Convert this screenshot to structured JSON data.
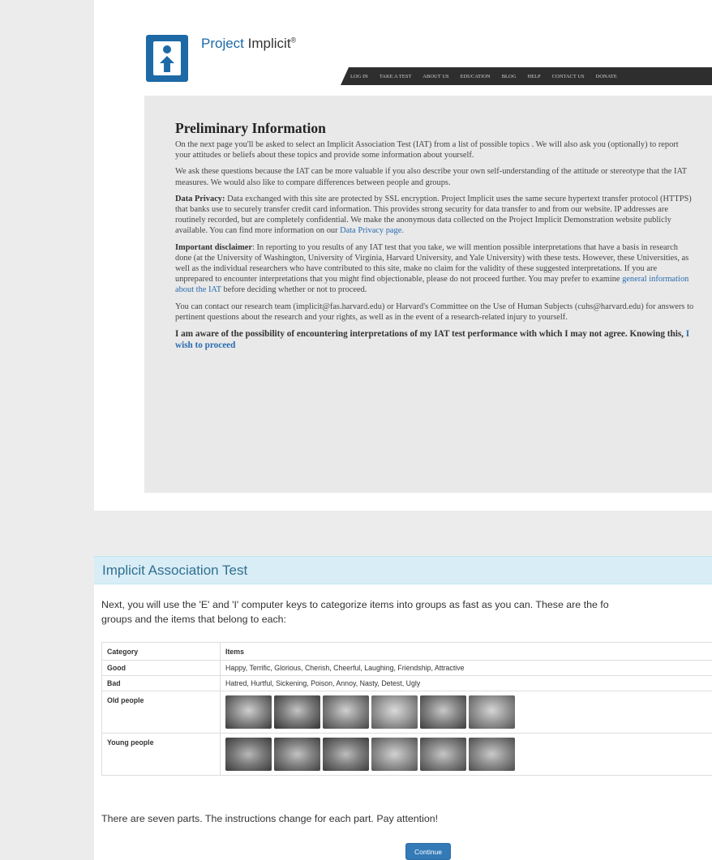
{
  "brand": {
    "name_part1": "Project",
    "name_part2": " Implicit",
    "mark": "®"
  },
  "nav": {
    "items": [
      "LOG IN",
      "TAKE A TEST",
      "ABOUT US",
      "EDUCATION",
      "BLOG",
      "HELP",
      "CONTACT US",
      "DONATE"
    ]
  },
  "prelim": {
    "title": "Preliminary Information",
    "p1": "On the next page you'll be asked to select an Implicit Association Test (IAT) from a list of possible topics . We will also ask you (optionally) to report your attitudes or beliefs about these topics and provide some information about yourself.",
    "p2": "We ask these questions because the IAT can be more valuable if you also describe your own self-understanding of the attitude or stereotype that the IAT measures. We would also like to compare differences between people and groups.",
    "privacy_label": "Data Privacy:",
    "privacy_text": " Data exchanged with this site are protected by SSL encryption. Project Implicit uses the same secure hypertext transfer protocol (HTTPS) that banks use to securely transfer credit card information. This provides strong security for data transfer to and from our website. IP addresses are routinely recorded, but are completely confidential. We make the anonymous data collected on the Project Implicit Demonstration website publicly available. You can find more information on our ",
    "privacy_link": "Data Privacy page.",
    "disclaimer_label": "Important disclaimer",
    "disclaimer_text": ": In reporting to you results of any IAT test that you take, we will mention possible interpretations that have a basis in research done (at the University of Washington, University of Virginia, Harvard University, and Yale University) with these tests. However, these Universities, as well as the individual researchers who have contributed to this site, make no claim for the validity of these suggested interpretations. If you are unprepared to encounter interpretations that you might find objectionable, please do not proceed further. You may prefer to examine ",
    "disclaimer_link": "general information about the IAT",
    "disclaimer_tail": " before deciding whether or not to proceed.",
    "contact": "You can contact our research team (implicit@fas.harvard.edu) or Harvard's Committee on the Use of Human Subjects (cuhs@harvard.edu) for answers to pertinent questions about the research and your rights, as well as in the event of a research-related injury to yourself.",
    "final_text": "I am aware of the possibility of encountering interpretations of my IAT test performance with which I may not agree. Knowing this, ",
    "final_link": "I wish to proceed"
  },
  "iat": {
    "title": "Implicit Association Test",
    "lead_line1": "Next, you will use the 'E' and 'I' computer keys to categorize items into groups as fast as you can. These are the fo",
    "lead_line2": "groups and the items that belong to each:",
    "table": {
      "headers": [
        "Category",
        "Items"
      ],
      "rows": [
        {
          "category": "Good",
          "items": "Happy, Terrific, Glorious, Cherish, Cheerful, Laughing, Friendship, Attractive"
        },
        {
          "category": "Bad",
          "items": "Hatred, Hurtful, Sickening, Poison, Annoy, Nasty, Detest, Ugly"
        },
        {
          "category": "Old people",
          "items": ""
        },
        {
          "category": "Young people",
          "items": ""
        }
      ]
    },
    "parts_text": "There are seven parts. The instructions change for each part. Pay attention!",
    "continue_label": "Continue"
  }
}
